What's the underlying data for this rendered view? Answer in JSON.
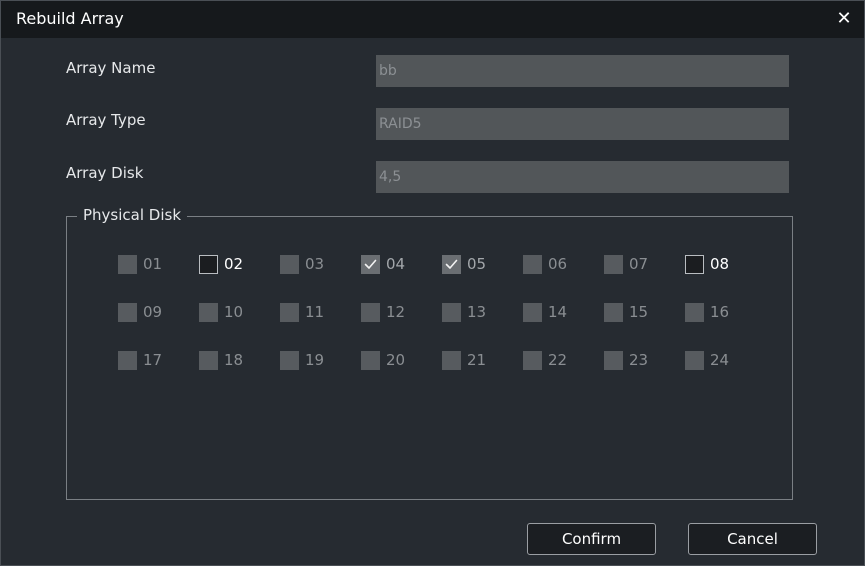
{
  "dialog": {
    "title": "Rebuild Array",
    "close_symbol": "✕",
    "close_icon": "close-icon"
  },
  "fields": {
    "array_name": {
      "label": "Array Name",
      "value": "bb"
    },
    "array_type": {
      "label": "Array Type",
      "value": "RAID5"
    },
    "array_disk": {
      "label": "Array Disk",
      "value": "4,5"
    }
  },
  "physical_disk": {
    "legend": "Physical Disk",
    "disks": [
      {
        "id": "01",
        "state": "disabled"
      },
      {
        "id": "02",
        "state": "available"
      },
      {
        "id": "03",
        "state": "disabled"
      },
      {
        "id": "04",
        "state": "checked"
      },
      {
        "id": "05",
        "state": "checked"
      },
      {
        "id": "06",
        "state": "disabled"
      },
      {
        "id": "07",
        "state": "disabled"
      },
      {
        "id": "08",
        "state": "available"
      },
      {
        "id": "09",
        "state": "disabled"
      },
      {
        "id": "10",
        "state": "disabled"
      },
      {
        "id": "11",
        "state": "disabled"
      },
      {
        "id": "12",
        "state": "disabled"
      },
      {
        "id": "13",
        "state": "disabled"
      },
      {
        "id": "14",
        "state": "disabled"
      },
      {
        "id": "15",
        "state": "disabled"
      },
      {
        "id": "16",
        "state": "disabled"
      },
      {
        "id": "17",
        "state": "disabled"
      },
      {
        "id": "18",
        "state": "disabled"
      },
      {
        "id": "19",
        "state": "disabled"
      },
      {
        "id": "20",
        "state": "disabled"
      },
      {
        "id": "21",
        "state": "disabled"
      },
      {
        "id": "22",
        "state": "disabled"
      },
      {
        "id": "23",
        "state": "disabled"
      },
      {
        "id": "24",
        "state": "disabled"
      }
    ]
  },
  "buttons": {
    "confirm_label": "Confirm",
    "cancel_label": "Cancel"
  },
  "colors": {
    "dialog_bg": "#262b31",
    "titlebar_bg": "#16191c",
    "input_bg": "#525659",
    "checkbox_disabled": "#575b5f",
    "checkbox_checked": "#6a6e72",
    "checkbox_available": "#1b1d20"
  }
}
